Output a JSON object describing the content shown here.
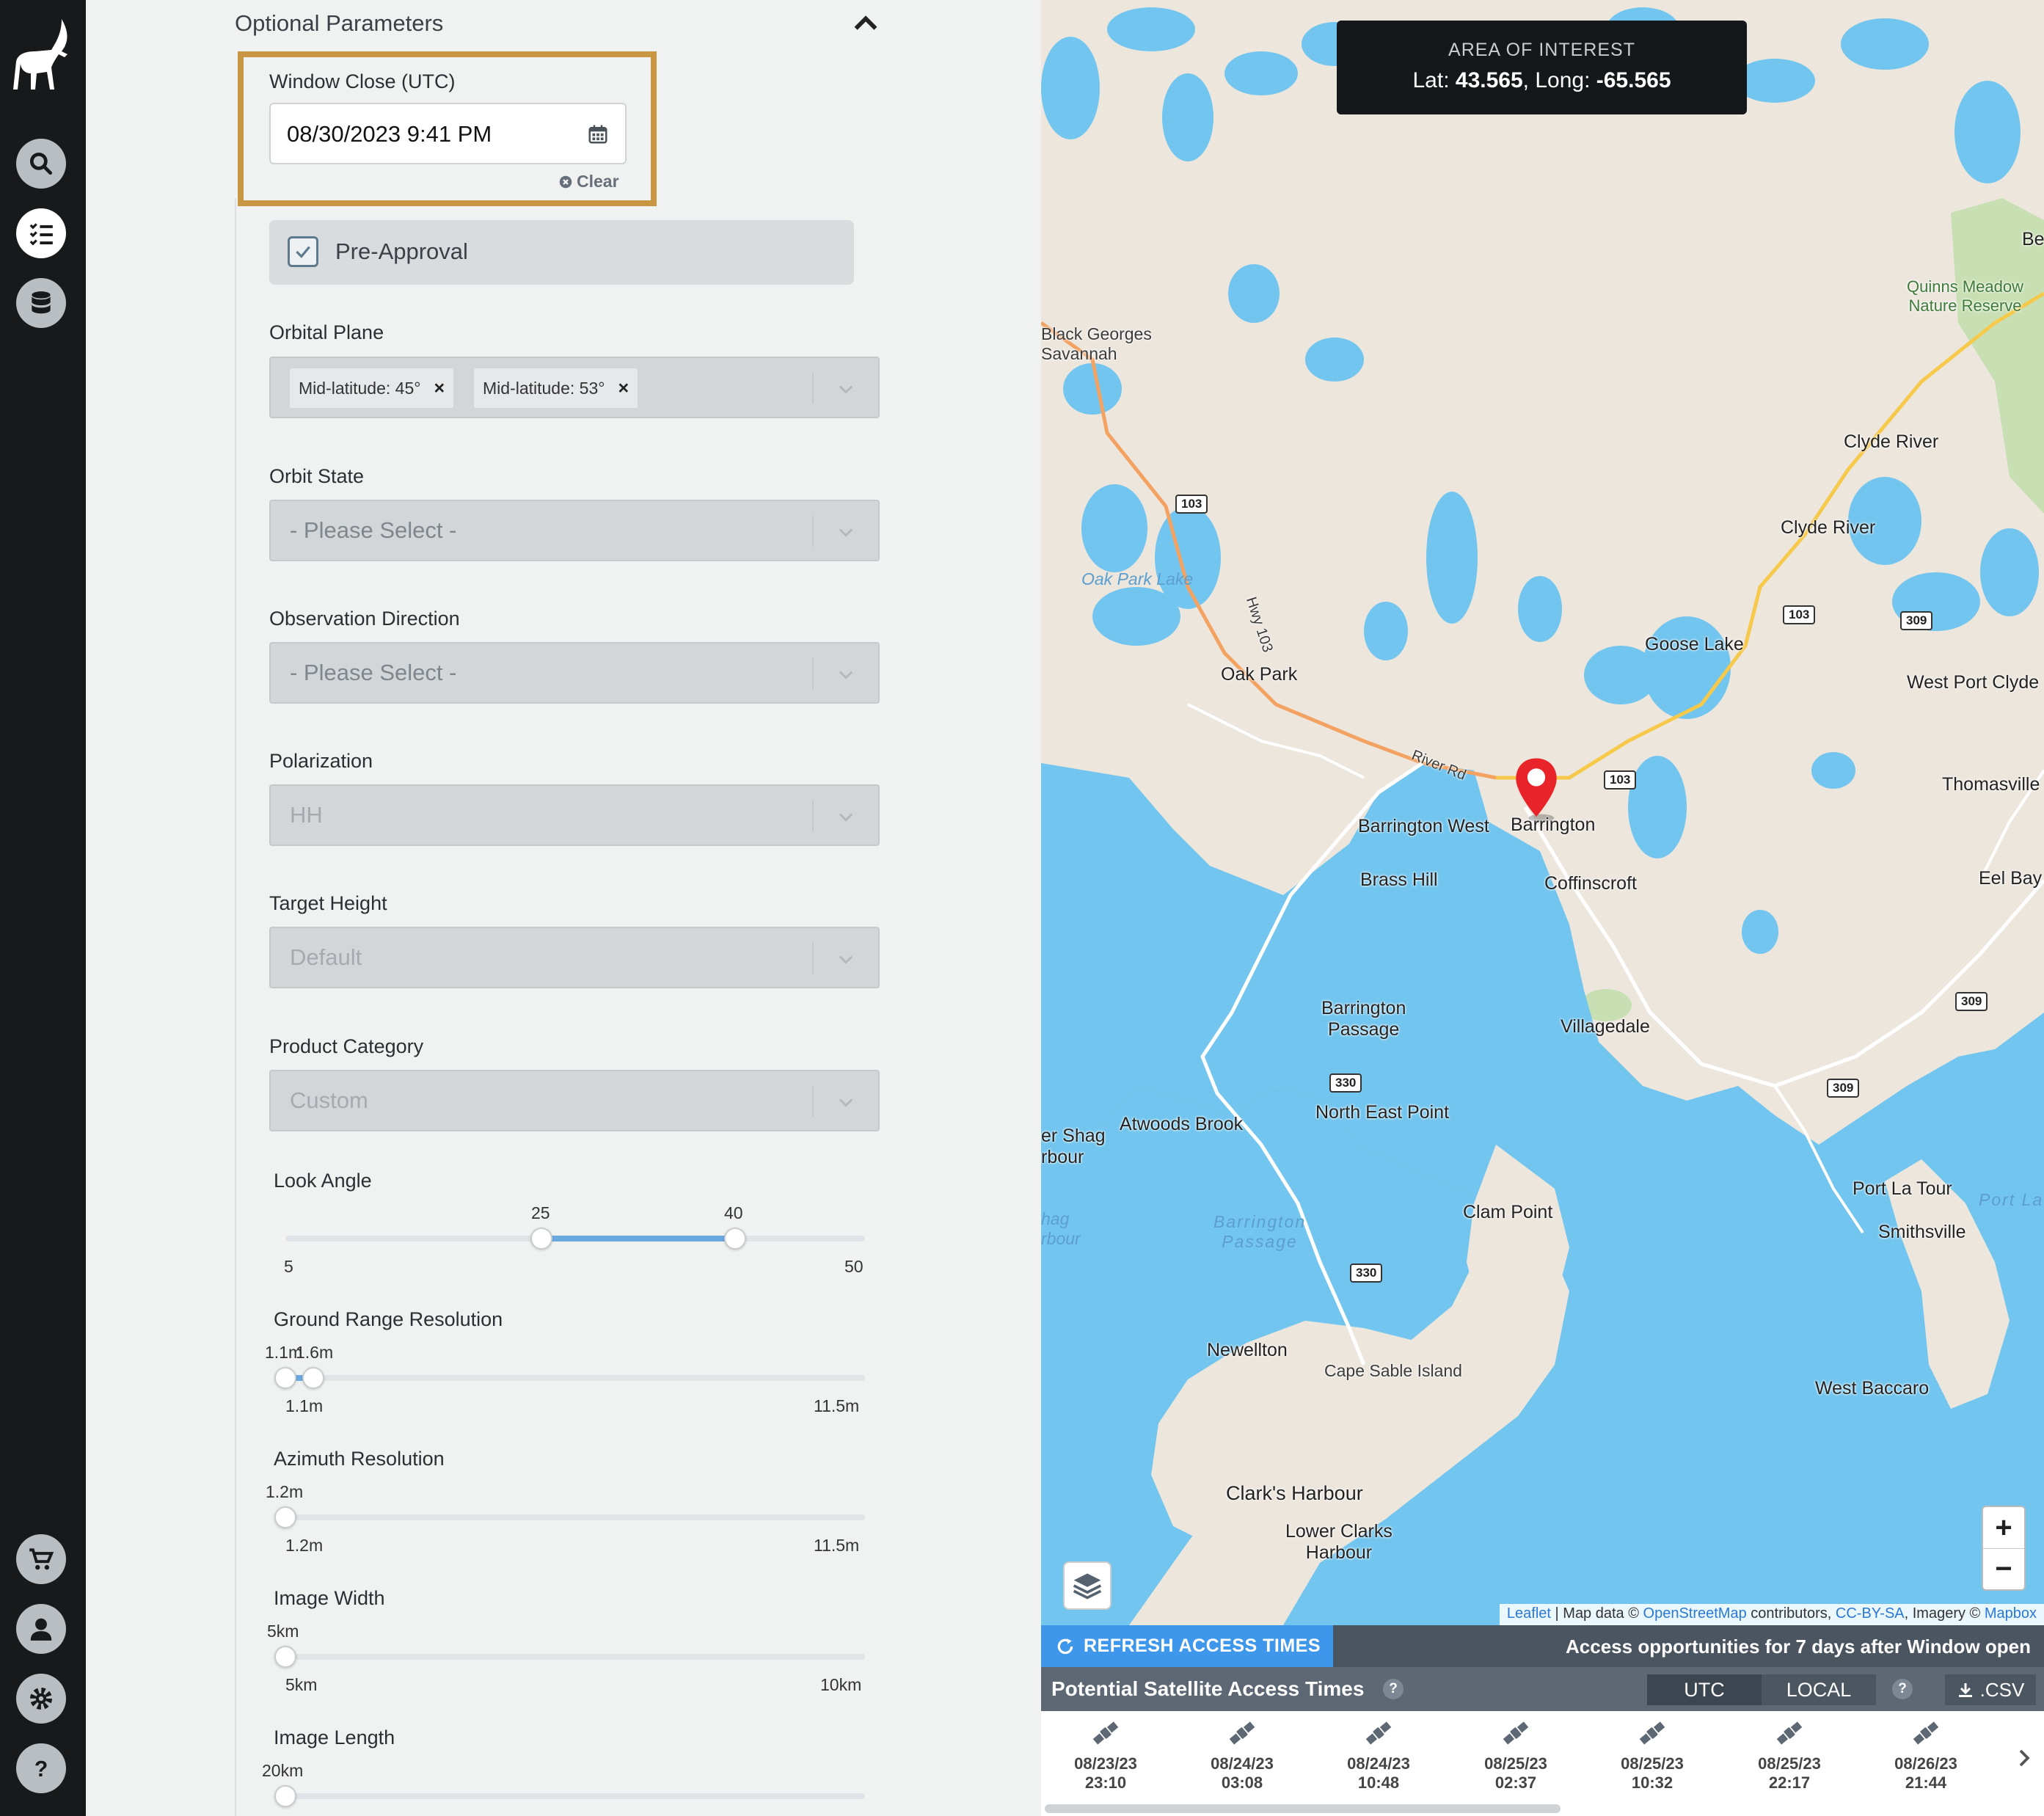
{
  "sidebar": {
    "items": [
      {
        "icon": "search-icon"
      },
      {
        "icon": "checklist-icon",
        "active": true
      },
      {
        "icon": "database-icon"
      },
      {
        "icon": "cart-icon"
      },
      {
        "icon": "user-icon"
      },
      {
        "icon": "gear-icon"
      },
      {
        "icon": "help-icon"
      }
    ]
  },
  "form": {
    "section_title": "Optional Parameters",
    "window_close": {
      "label": "Window Close (UTC)",
      "value": "08/30/2023 9:41 PM",
      "clear_label": "Clear"
    },
    "pre_approval": {
      "label": "Pre-Approval",
      "checked": true
    },
    "orbital_plane": {
      "label": "Orbital Plane",
      "tags": [
        "Mid-latitude: 45°",
        "Mid-latitude: 53°"
      ]
    },
    "orbit_state": {
      "label": "Orbit State",
      "placeholder": "- Please Select -"
    },
    "observation_direction": {
      "label": "Observation Direction",
      "placeholder": "- Please Select -"
    },
    "polarization": {
      "label": "Polarization",
      "value": "HH"
    },
    "target_height": {
      "label": "Target Height",
      "value": "Default"
    },
    "product_category": {
      "label": "Product Category",
      "value": "Custom"
    },
    "look_angle": {
      "label": "Look Angle",
      "low": "25",
      "high": "40",
      "min": "5",
      "max": "50",
      "low_value": 25,
      "high_value": 40,
      "range": [
        5,
        50
      ]
    },
    "ground_range_resolution": {
      "label": "Ground Range Resolution",
      "low": "1.1m",
      "high": "1.6m",
      "min": "1.1m",
      "max": "11.5m",
      "low_value": 1.1,
      "high_value": 1.6,
      "range": [
        1.1,
        11.5
      ]
    },
    "azimuth_resolution": {
      "label": "Azimuth Resolution",
      "value": "1.2m",
      "min": "1.2m",
      "max": "11.5m",
      "current": 1.2,
      "range": [
        1.2,
        11.5
      ]
    },
    "image_width": {
      "label": "Image Width",
      "value": "5km",
      "min": "5km",
      "max": "10km",
      "current": 5,
      "range": [
        5,
        10
      ]
    },
    "image_length": {
      "label": "Image Length",
      "value": "20km",
      "current": 20
    }
  },
  "map": {
    "aoi_title": "AREA OF INTEREST",
    "lat_label": "Lat:",
    "lat": "43.565",
    "long_label": ", Long:",
    "long": "-65.565",
    "labels": {
      "black_georges": "Black Georges\nSavannah",
      "oak_park_lake": "Oak Park Lake",
      "hwy103": "Hwy 103",
      "oak_park": "Oak Park",
      "river_rd": "River Rd",
      "barrington_west": "Barrington West",
      "barrington": "Barrington",
      "brass_hill": "Brass Hill",
      "coffinscroft": "Coffinscroft",
      "goose_lake": "Goose Lake",
      "clyde_river_1": "Clyde River",
      "clyde_river_2": "Clyde River",
      "quinns": "Quinns Meadow\nNature Reserve",
      "be": "Be",
      "west_port_clyde": "West Port Clyde",
      "thomasville": "Thomasville",
      "eel_bay": "Eel Bay",
      "barrington_passage": "Barrington\nPassage",
      "villagedale": "Villagedale",
      "north_east_point": "North East Point",
      "atwoods_brook": "Atwoods Brook",
      "shag_harbour": "er Shag\nrbour",
      "shag_water": "hag\nrbour",
      "barrington_passage_water": "Barrington\nPassage",
      "clam_point": "Clam Point",
      "port_la_tour": "Port La Tour",
      "port_la_water": "Port La",
      "smithsville": "Smithsville",
      "newellton": "Newellton",
      "cape_sable_island": "Cape Sable Island",
      "west_baccaro": "West Baccaro",
      "clarks_harbour": "Clark's Harbour",
      "lower_clarks": "Lower Clarks\nHarbour"
    },
    "shields": {
      "s103a": "103",
      "s103b": "103",
      "s103c": "103",
      "s309a": "309",
      "s309b": "309",
      "s309c": "309",
      "s330a": "330",
      "s330b": "330"
    },
    "zoom_in": "+",
    "zoom_out": "−",
    "attribution": {
      "leaflet": "Leaflet",
      "sep1": " | Map data © ",
      "osm": "OpenStreetMap",
      "sep2": " contributors, ",
      "cc": "CC-BY-SA",
      "sep3": ", Imagery © ",
      "mapbox": "Mapbox"
    }
  },
  "access": {
    "refresh_label": "REFRESH ACCESS TIMES",
    "note": "Access opportunities for 7 days after Window open",
    "title": "Potential Satellite Access Times",
    "help": "?",
    "utc": "UTC",
    "local": "LOCAL",
    "csv": ".CSV",
    "times": [
      {
        "date": "08/23/23",
        "time": "23:10"
      },
      {
        "date": "08/24/23",
        "time": "03:08"
      },
      {
        "date": "08/24/23",
        "time": "10:48"
      },
      {
        "date": "08/25/23",
        "time": "02:37"
      },
      {
        "date": "08/25/23",
        "time": "10:32"
      },
      {
        "date": "08/25/23",
        "time": "22:17"
      },
      {
        "date": "08/26/23",
        "time": "21:44"
      }
    ]
  },
  "colors": {
    "accent": "#3e97ea",
    "highlight": "#c99643",
    "rail": "#17191b",
    "water": "#72c5ee",
    "land": "#ece6dd",
    "marker": "#e8242a"
  }
}
